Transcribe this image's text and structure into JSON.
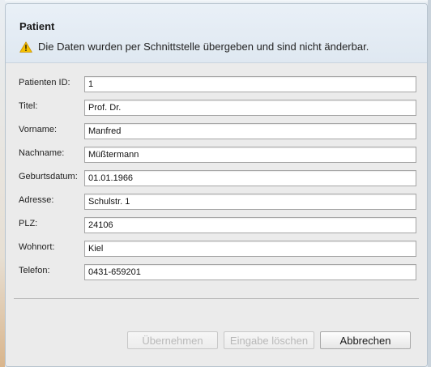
{
  "dialog": {
    "title": "Patient",
    "notice": "Die Daten wurden per Schnittstelle übergeben und sind nicht änderbar.",
    "notice_icon": "warning-icon"
  },
  "fields": [
    {
      "label": "Patienten ID:",
      "value": "1"
    },
    {
      "label": "Titel:",
      "value": "Prof. Dr."
    },
    {
      "label": "Vorname:",
      "value": "Manfred"
    },
    {
      "label": "Nachname:",
      "value": "Müßtermann"
    },
    {
      "label": "Geburtsdatum:",
      "value": "01.01.1966"
    },
    {
      "label": "Adresse:",
      "value": "Schulstr. 1"
    },
    {
      "label": "PLZ:",
      "value": "24106"
    },
    {
      "label": "Wohnort:",
      "value": "Kiel"
    },
    {
      "label": "Telefon:",
      "value": "0431-659201"
    }
  ],
  "buttons": {
    "apply": "Übernehmen",
    "clear": "Eingabe löschen",
    "cancel": "Abbrechen"
  },
  "colors": {
    "warning": "#f2b600",
    "header_bg": "#e3ebf3",
    "body_bg": "#ebebeb"
  }
}
